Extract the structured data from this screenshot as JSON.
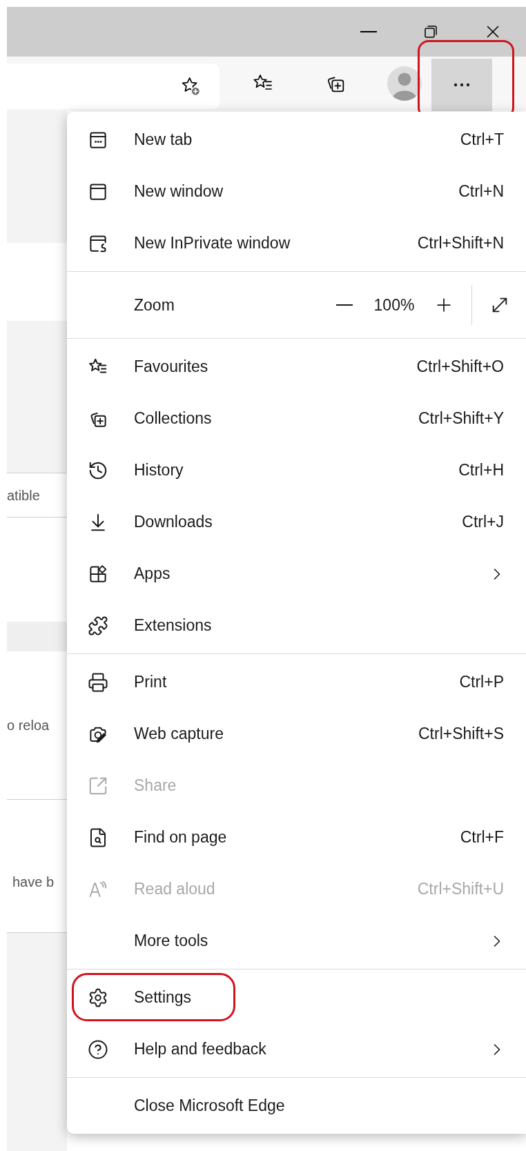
{
  "toolbar": {
    "more_button": {
      "annotated": true
    }
  },
  "background_page": {
    "fragments": [
      "atible",
      "o reloa",
      "have b"
    ]
  },
  "menu": {
    "sections": [
      {
        "items": [
          {
            "kind": "item",
            "label": "New tab",
            "shortcut": "Ctrl+T",
            "disabled": false,
            "submenu": false,
            "annotated": false
          },
          {
            "kind": "item",
            "label": "New window",
            "shortcut": "Ctrl+N",
            "disabled": false,
            "submenu": false,
            "annotated": false
          },
          {
            "kind": "item",
            "label": "New InPrivate window",
            "shortcut": "Ctrl+Shift+N",
            "disabled": false,
            "submenu": false,
            "annotated": false
          }
        ]
      },
      {
        "items": [
          {
            "kind": "zoom",
            "label": "Zoom",
            "value": "100%"
          }
        ]
      },
      {
        "items": [
          {
            "kind": "item",
            "label": "Favourites",
            "shortcut": "Ctrl+Shift+O",
            "disabled": false,
            "submenu": false,
            "annotated": false
          },
          {
            "kind": "item",
            "label": "Collections",
            "shortcut": "Ctrl+Shift+Y",
            "disabled": false,
            "submenu": false,
            "annotated": false
          },
          {
            "kind": "item",
            "label": "History",
            "shortcut": "Ctrl+H",
            "disabled": false,
            "submenu": false,
            "annotated": false
          },
          {
            "kind": "item",
            "label": "Downloads",
            "shortcut": "Ctrl+J",
            "disabled": false,
            "submenu": false,
            "annotated": false
          },
          {
            "kind": "item",
            "label": "Apps",
            "disabled": false,
            "submenu": true,
            "annotated": false
          },
          {
            "kind": "item",
            "label": "Extensions",
            "disabled": false,
            "submenu": false,
            "annotated": false
          }
        ]
      },
      {
        "items": [
          {
            "kind": "item",
            "label": "Print",
            "shortcut": "Ctrl+P",
            "disabled": false,
            "submenu": false,
            "annotated": false
          },
          {
            "kind": "item",
            "label": "Web capture",
            "shortcut": "Ctrl+Shift+S",
            "disabled": false,
            "submenu": false,
            "annotated": false
          },
          {
            "kind": "item",
            "label": "Share",
            "disabled": true,
            "submenu": false,
            "annotated": false
          },
          {
            "kind": "item",
            "label": "Find on page",
            "shortcut": "Ctrl+F",
            "disabled": false,
            "submenu": false,
            "annotated": false
          },
          {
            "kind": "item",
            "label": "Read aloud",
            "shortcut": "Ctrl+Shift+U",
            "disabled": true,
            "submenu": false,
            "annotated": false
          },
          {
            "kind": "item",
            "label": "More tools",
            "disabled": false,
            "submenu": true,
            "annotated": false
          }
        ]
      },
      {
        "items": [
          {
            "kind": "item",
            "label": "Settings",
            "disabled": false,
            "submenu": false,
            "annotated": true
          },
          {
            "kind": "item",
            "label": "Help and feedback",
            "disabled": false,
            "submenu": true,
            "annotated": false
          }
        ]
      },
      {
        "items": [
          {
            "kind": "item",
            "label": "Close Microsoft Edge",
            "disabled": false,
            "submenu": false,
            "annotated": false
          }
        ]
      }
    ]
  }
}
